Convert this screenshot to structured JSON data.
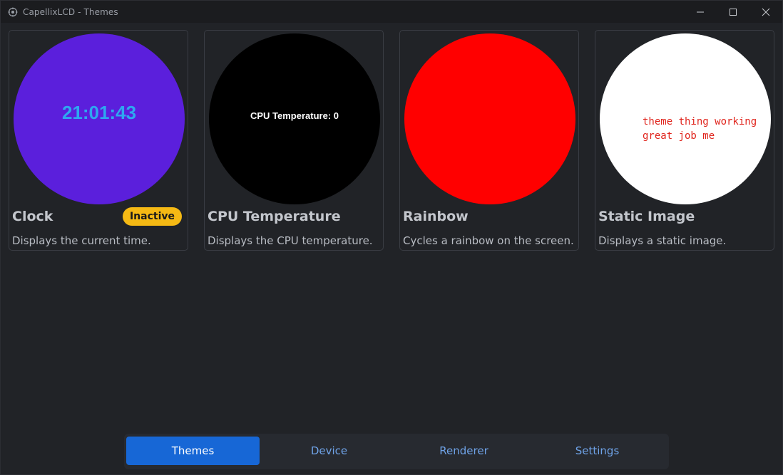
{
  "window": {
    "title": "CapellixLCD - Themes"
  },
  "themes": [
    {
      "title": "Clock",
      "description": "Displays the current time.",
      "badge": "Inactive",
      "preview_text": "21:01:43",
      "preview_bg": "#5b1fdc",
      "preview_text_color": "#2ea8f0"
    },
    {
      "title": "CPU Temperature",
      "description": "Displays the CPU temperature.",
      "preview_text": "CPU Temperature: 0",
      "preview_bg": "#000000",
      "preview_text_color": "#ffffff"
    },
    {
      "title": "Rainbow",
      "description": "Cycles a rainbow on the screen.",
      "preview_bg": "#ff0000"
    },
    {
      "title": "Static Image",
      "description": "Displays a static image.",
      "preview_text_lines": [
        "theme thing working",
        "great job me"
      ],
      "preview_bg": "#ffffff",
      "preview_text_color": "#e0241c"
    }
  ],
  "nav": {
    "items": [
      {
        "label": "Themes",
        "active": true
      },
      {
        "label": "Device",
        "active": false
      },
      {
        "label": "Renderer",
        "active": false
      },
      {
        "label": "Settings",
        "active": false
      }
    ]
  },
  "colors": {
    "background": "#212327",
    "titlebar": "#1b1c1f",
    "accent": "#1767d6",
    "badge": "#f5b914",
    "nav_text": "#6fa3e8"
  },
  "icons": {
    "app": "gear-icon",
    "minimize": "minimize-icon",
    "maximize": "maximize-icon",
    "close": "close-icon"
  }
}
